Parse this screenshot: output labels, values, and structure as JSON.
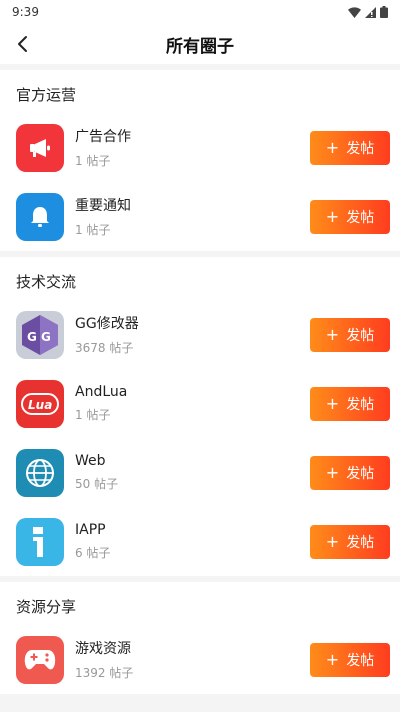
{
  "status": {
    "time": "9:39"
  },
  "header": {
    "title": "所有圈子"
  },
  "post_button": {
    "plus": "+",
    "label": "发帖"
  },
  "sections": [
    {
      "title": "官方运营",
      "items": [
        {
          "name": "广告合作",
          "count": "1 帖子",
          "icon": "megaphone-icon",
          "color": "#f2343b"
        },
        {
          "name": "重要通知",
          "count": "1 帖子",
          "icon": "bell-icon",
          "color": "#1e8fe0"
        }
      ]
    },
    {
      "title": "技术交流",
      "items": [
        {
          "name": "GG修改器",
          "count": "3678 帖子",
          "icon": "gg-logo-icon",
          "color": "#6b4ea1"
        },
        {
          "name": "AndLua",
          "count": "1 帖子",
          "icon": "lua-logo-icon",
          "color": "#e8322f"
        },
        {
          "name": "Web",
          "count": "50 帖子",
          "icon": "globe-icon",
          "color": "#1f8db3"
        },
        {
          "name": "IAPP",
          "count": "6 帖子",
          "icon": "iapp-logo-icon",
          "color": "#3ab6e6"
        }
      ]
    },
    {
      "title": "资源分享",
      "items": [
        {
          "name": "游戏资源",
          "count": "1392 帖子",
          "icon": "gamepad-icon",
          "color": "#f0594f"
        }
      ]
    }
  ]
}
